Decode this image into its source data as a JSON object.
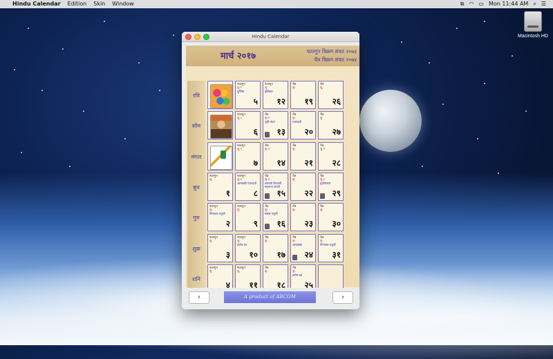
{
  "menubar": {
    "app_name": "Hindu Calendar",
    "items": [
      "Edition",
      "Skin",
      "Window"
    ],
    "clock": "Mon 11:44 AM"
  },
  "desktop": {
    "drive_label": "Macintosh HD"
  },
  "window": {
    "title": "Hindu Calendar",
    "month_title": "मार्च २०१७",
    "samvat_1": "फाल्गुन विक्रम संवत २०७३",
    "samvat_2": "चैत्र विक्रम संवत २०७४",
    "days": [
      "रवि",
      "सोम",
      "मंगल",
      "बुध",
      "गुरु",
      "शुक्र",
      "शनि"
    ],
    "calendar": [
      [
        {
          "thumb": "colors"
        },
        {
          "m": "फाल्गुन",
          "t": "शु.१",
          "f": "पूर्णिमा",
          "n": "५"
        },
        {
          "m": "फाल्गुन",
          "t": "शु.",
          "f": "होलिका",
          "n": "१२"
        },
        {
          "m": "चैत्र",
          "t": "कृ.",
          "f": "",
          "n": "१९"
        },
        {
          "m": "चैत्र",
          "t": "शु.",
          "f": "",
          "n": "२६"
        }
      ],
      [
        {
          "thumb": "shivaji"
        },
        {
          "m": "फाल्गुन",
          "t": "शु.८",
          "f": "",
          "n": "६"
        },
        {
          "m": "चैत्र",
          "t": "कृ.१",
          "f": "धुलि वंदन",
          "n": "१३",
          "mini": true
        },
        {
          "m": "चैत्र",
          "t": "कृ.",
          "f": "एकादशी",
          "n": "२०"
        },
        {
          "m": "चैत्र",
          "t": "शु.",
          "f": "",
          "n": "२७"
        }
      ],
      [
        {
          "thumb": "gudi"
        },
        {
          "m": "फाल्गुन",
          "t": "शु.९",
          "f": "",
          "n": "७"
        },
        {
          "m": "चैत्र",
          "t": "कृ.२",
          "f": "",
          "n": "१४"
        },
        {
          "m": "चैत्र",
          "t": "कृ.",
          "f": "",
          "n": "२१"
        },
        {
          "m": "चैत्र",
          "t": "शु.२",
          "f": "",
          "n": "२८"
        }
      ],
      [
        {
          "m": "फाल्गुन",
          "t": "शु.",
          "f": "",
          "n": "१"
        },
        {
          "m": "फाल्गुन",
          "t": "शु.१",
          "f": "आमलकी एकादशी",
          "n": "८"
        },
        {
          "m": "चैत्र",
          "t": "कृ.३",
          "f": "छत्रपती शिवाजी महाराज जयंती",
          "n": "१५",
          "mini": true
        },
        {
          "m": "चैत्र",
          "t": "कृ.",
          "f": "",
          "n": "२२"
        },
        {
          "m": "चैत्र",
          "t": "शु.३",
          "f": "गुढीपाडवा",
          "n": "२९",
          "mini": true
        }
      ],
      [
        {
          "m": "फाल्गुन",
          "t": "शु.",
          "f": "विनायक चतुर्थी",
          "n": "२"
        },
        {
          "m": "फाल्गुन",
          "t": "शु.",
          "f": "",
          "n": "९"
        },
        {
          "m": "चैत्र",
          "t": "कृ.",
          "f": "संकष्ट चतुर्थी",
          "n": "१६",
          "mini": true
        },
        {
          "m": "चैत्र",
          "t": "कृ.",
          "f": "",
          "n": "२३"
        },
        {
          "m": "चैत्र",
          "t": "शु.",
          "f": "",
          "n": "३०"
        }
      ],
      [
        {
          "m": "फाल्गुन",
          "t": "शु.",
          "f": "",
          "n": "३"
        },
        {
          "m": "फाल्गुन",
          "t": "शु.",
          "f": "प्रदोष व्रत",
          "n": "१०"
        },
        {
          "m": "चैत्र",
          "t": "कृ.",
          "f": "",
          "n": "१७"
        },
        {
          "m": "चैत्र",
          "t": "कृ.",
          "f": "अमावस्या",
          "n": "२४",
          "mini": true
        },
        {
          "m": "चैत्र",
          "t": "शु.",
          "f": "विनायक चतुर्थी",
          "n": "३१"
        }
      ],
      [
        {
          "m": "फाल्गुन",
          "t": "शु.",
          "f": "",
          "n": "४"
        },
        {
          "m": "फाल्गुन",
          "t": "शु.",
          "f": "",
          "n": "११"
        },
        {
          "m": "चैत्र",
          "t": "कृ.",
          "f": "",
          "n": "१८"
        },
        {
          "m": "चैत्र",
          "t": "कृ.",
          "f": "प्रदोष व्रत",
          "n": "२५"
        },
        {
          "empty": true
        }
      ]
    ],
    "prev_label": "‹",
    "next_label": "›",
    "credit": "A product of ABCOM"
  }
}
